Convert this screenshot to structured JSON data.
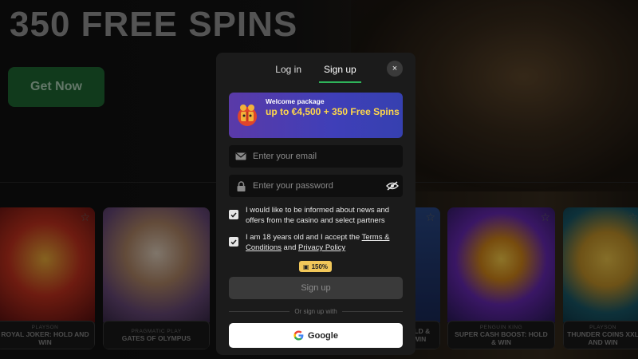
{
  "hero": {
    "title": "350 FREE SPINS",
    "cta": "Get Now"
  },
  "games": [
    {
      "provider": "PLAYSON",
      "name": "ROYAL JOKER: HOLD AND WIN"
    },
    {
      "provider": "PRAGMATIC PLAY",
      "name": "GATES OF OLYMPUS"
    },
    {
      "provider": "",
      "name": "OLD & WIN"
    },
    {
      "provider": "PENGUIN KING",
      "name": "SUPER CASH BOOST: HOLD & WIN"
    },
    {
      "provider": "PLAYSON",
      "name": "THUNDER COINS XXL AND WIN"
    }
  ],
  "modal": {
    "tabs": [
      "Log in",
      "Sign up"
    ],
    "active_tab": "Sign up",
    "close": "×",
    "promo": {
      "kicker": "Welcome package",
      "title": "up to €4,500 + 350 Free Spins"
    },
    "email_placeholder": "Enter your email",
    "password_placeholder": "Enter your password",
    "news_checkbox": "I would like to be informed about news and offers from the casino and select partners",
    "terms": {
      "prefix": "I am 18 years old and I accept the ",
      "terms_link": "Terms & Conditions",
      "and": " and ",
      "privacy_link": "Privacy Policy"
    },
    "bonus_badge": "150%",
    "signup_button": "Sign up",
    "or_text": "Or sign up with",
    "google_button": "Google"
  },
  "colors": {
    "accent_green": "#2fb45a",
    "promo_yellow": "#ffd84a",
    "promo_purple": "#5a3aa8"
  }
}
